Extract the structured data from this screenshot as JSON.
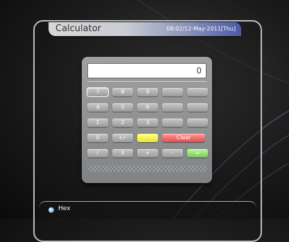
{
  "titlebar": {
    "title": "Calculator",
    "datetime": "08:02/12-May-2011[Thu]"
  },
  "display": {
    "value": "0"
  },
  "keys": {
    "k7": "7",
    "k8": "8",
    "k9": "9",
    "k4": "4",
    "k5": "5",
    "k6": "6",
    "k1": "1",
    "k2": "2",
    "k3": "3",
    "k0": "0",
    "plusminus": "+/-",
    "dot": ".",
    "clear": "Clear",
    "divide": "/",
    "multiply": "X",
    "plus": "+",
    "minus": "-",
    "equals": "="
  },
  "status": {
    "mode_label": "Hex"
  },
  "colors": {
    "yellow_key": "#e8e62a",
    "red_key": "#e34a4a",
    "green_key": "#6fce4f",
    "title_accent": "#4b5aa7"
  }
}
